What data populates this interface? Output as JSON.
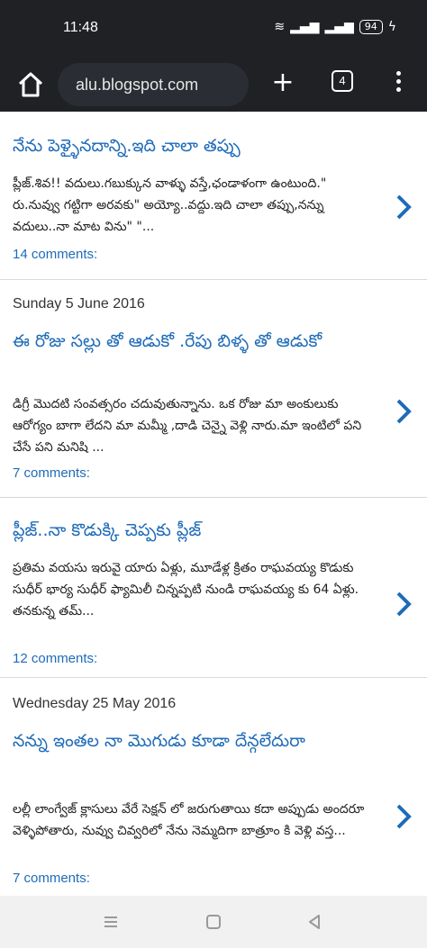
{
  "status": {
    "time": "11:48",
    "battery": "94"
  },
  "toolbar": {
    "url": "alu.blogspot.com",
    "tab_count": "4"
  },
  "posts": [
    {
      "title": "నేను పెళ్ళైనదాన్ని.ఇది చాలా తప్పు",
      "snippet": "ప్లీజ్.శివ!! వదులు.గబుక్కున వాళ్ళు వస్తే,ఛండాళంగా ఉంటుంది.\" రు.నువ్వు గట్టిగా అరవకు\" అయ్యో..వద్దు.ఇది చాలా తప్పు,నన్ను వదులు..నా మాట విను\" \"...",
      "comments": "14 comments:"
    },
    {
      "date": "Sunday 5 June 2016",
      "title": "ఈ రోజు సల్లు తో ఆడుకో .రేపు బిళ్ళ తో ఆడుకో",
      "snippet": "డిగ్రీ మొదటి సంవత్సరం చదువుతున్నాను. ఒక రోజు మా అంకులుకు ఆరోగ్యం బాగా లేదని మా మమ్మీ ,దాడి చెన్నై వెళ్లి నారు.మా ఇంటిలో పని చేసే పని మనిషి ...",
      "comments": "7 comments:"
    },
    {
      "title": "ప్లీజ్..నా కొడుక్కి చెప్పకు ప్లీజ్",
      "snippet": "ప్రతిమ వయసు ఇరువై యారు ఏళ్లు, మూడేళ్ల క్రితం రాఘవయ్య కొడుకు సుధీర్ భార్య సుధీర్ ఫ్యామిలీ చిన్నప్పటి నుండి రాఘవయ్య కు 64 ఏళ్లు. తనకున్న తమ్...",
      "comments": "12 comments:"
    },
    {
      "date": "Wednesday 25 May 2016",
      "title": "నన్ను ఇంతల నా మొగుడు కూడా దేన్గలేదురా",
      "snippet": "లల్లీ లాంగ్వేజ్ క్లాసులు వేరే సెక్షన్ లో జరుగుతాయి కదా అప్పుడు అందరూ వెళ్ళిపోతారు, నువ్వు చివ్వరిలో నేను నెమ్మదిగా బాత్రూం కి వెళ్లి వస్త...",
      "comments": "7 comments:"
    }
  ],
  "colors": {
    "link": "#1e6bb8",
    "chrome": "#1f2125"
  },
  "icons": [
    "home-icon",
    "plus-icon",
    "tabs-icon",
    "more-vert-icon",
    "chevron-right-icon",
    "recents-icon",
    "home-nav-icon",
    "back-icon"
  ]
}
